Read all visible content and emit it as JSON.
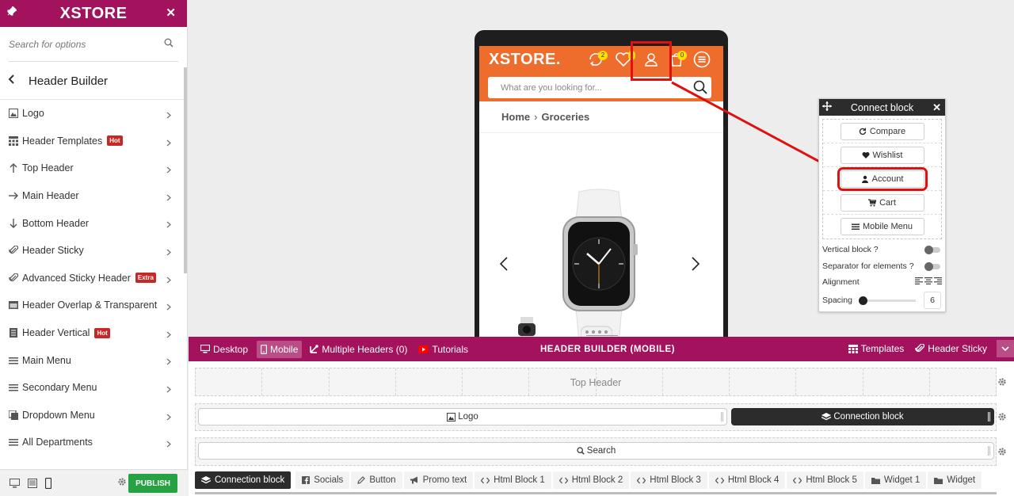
{
  "sidebar": {
    "brand": "XSTORE",
    "search_placeholder": "Search for options",
    "section_title": "Header Builder",
    "items": [
      {
        "label": "Logo",
        "icon": "image-icon",
        "badge": ""
      },
      {
        "label": "Header Templates",
        "icon": "templates-icon",
        "badge": "Hot"
      },
      {
        "label": "Top Header",
        "icon": "arrow-up-icon",
        "badge": ""
      },
      {
        "label": "Main Header",
        "icon": "arrow-right-icon",
        "badge": ""
      },
      {
        "label": "Bottom Header",
        "icon": "arrow-down-icon",
        "badge": ""
      },
      {
        "label": "Header Sticky",
        "icon": "paperclip-icon",
        "badge": ""
      },
      {
        "label": "Advanced Sticky Header",
        "icon": "paperclip-icon",
        "badge": "Extra"
      },
      {
        "label": "Header Overlap & Transparent",
        "icon": "overlap-icon",
        "badge": ""
      },
      {
        "label": "Header Vertical",
        "icon": "vertical-icon",
        "badge": "Hot"
      },
      {
        "label": "Main Menu",
        "icon": "menu-icon",
        "badge": ""
      },
      {
        "label": "Secondary Menu",
        "icon": "menu-icon",
        "badge": ""
      },
      {
        "label": "Dropdown Menu",
        "icon": "dropdown-icon",
        "badge": ""
      },
      {
        "label": "All Departments",
        "icon": "menu-icon",
        "badge": ""
      }
    ],
    "publish_label": "PUBLISH"
  },
  "preview": {
    "logo": "XSTORE.",
    "compare_count": "2",
    "wishlist_count": "",
    "cart_count": "0",
    "search_placeholder": "What are you looking for...",
    "breadcrumb": [
      "Home",
      "Groceries"
    ]
  },
  "connect_block": {
    "title": "Connect block",
    "items": [
      {
        "label": "Compare",
        "icon": "refresh-icon"
      },
      {
        "label": "Wishlist",
        "icon": "heart-icon"
      },
      {
        "label": "Account",
        "icon": "user-icon"
      },
      {
        "label": "Cart",
        "icon": "cart-icon"
      },
      {
        "label": "Mobile Menu",
        "icon": "menu-icon"
      }
    ],
    "vertical_label": "Vertical block ?",
    "separator_label": "Separator for elements ?",
    "alignment_label": "Alignment",
    "spacing_label": "Spacing",
    "spacing_value": "6",
    "vertical_on": false,
    "separator_on": false
  },
  "builder": {
    "title": "HEADER BUILDER (MOBILE)",
    "tabs": {
      "desktop": "Desktop",
      "mobile": "Mobile",
      "multiple": "Multiple Headers (0)",
      "tutorials": "Tutorials"
    },
    "templates_label": "Templates",
    "sticky_label": "Header Sticky",
    "top_header_label": "Top Header",
    "main_row": {
      "left": "Logo",
      "right": "Connection block"
    },
    "bottom_row": "Search",
    "elements": [
      "Connection block",
      "Socials",
      "Button",
      "Promo text",
      "Html Block 1",
      "Html Block 2",
      "Html Block 3",
      "Html Block 4",
      "Html Block 5",
      "Widget 1",
      "Widget"
    ]
  },
  "colors": {
    "brand": "#a3125c",
    "preview_header": "#ee6c2c",
    "highlight": "#e01010",
    "publish": "#27a243",
    "badge": "#c62828"
  }
}
